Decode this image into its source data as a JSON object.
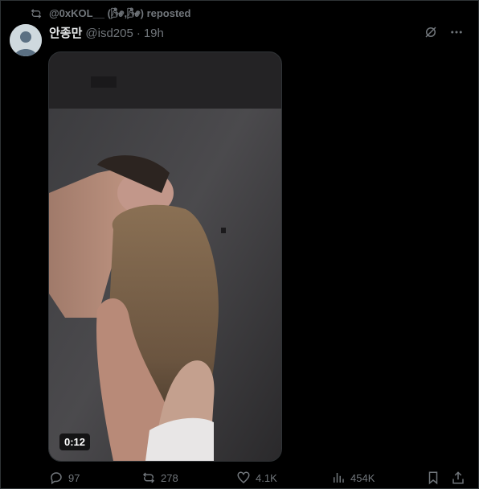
{
  "repost": {
    "text": "@0xKOL__ (",
    "emoji_1": "🌬",
    "separator": ",",
    "emoji_2": "🌬",
    "suffix": ") reposted"
  },
  "author": {
    "display_name": "안종만",
    "handle": "@isd205",
    "separator": "·",
    "time": "19h"
  },
  "media": {
    "type": "video",
    "duration": "0:12"
  },
  "stats": {
    "replies": "97",
    "reposts": "278",
    "likes": "4.1K",
    "views": "454K"
  },
  "colors": {
    "background": "#000000",
    "text_primary": "#e7e9ea",
    "text_secondary": "#71767b",
    "border": "#2f3336"
  },
  "icons": {
    "repost_indicator": "repost-icon",
    "grok": "grok-icon",
    "more": "more-icon",
    "reply": "reply-icon",
    "repost": "repost-icon",
    "like": "heart-icon",
    "views": "views-icon",
    "bookmark": "bookmark-icon",
    "share": "share-icon"
  }
}
